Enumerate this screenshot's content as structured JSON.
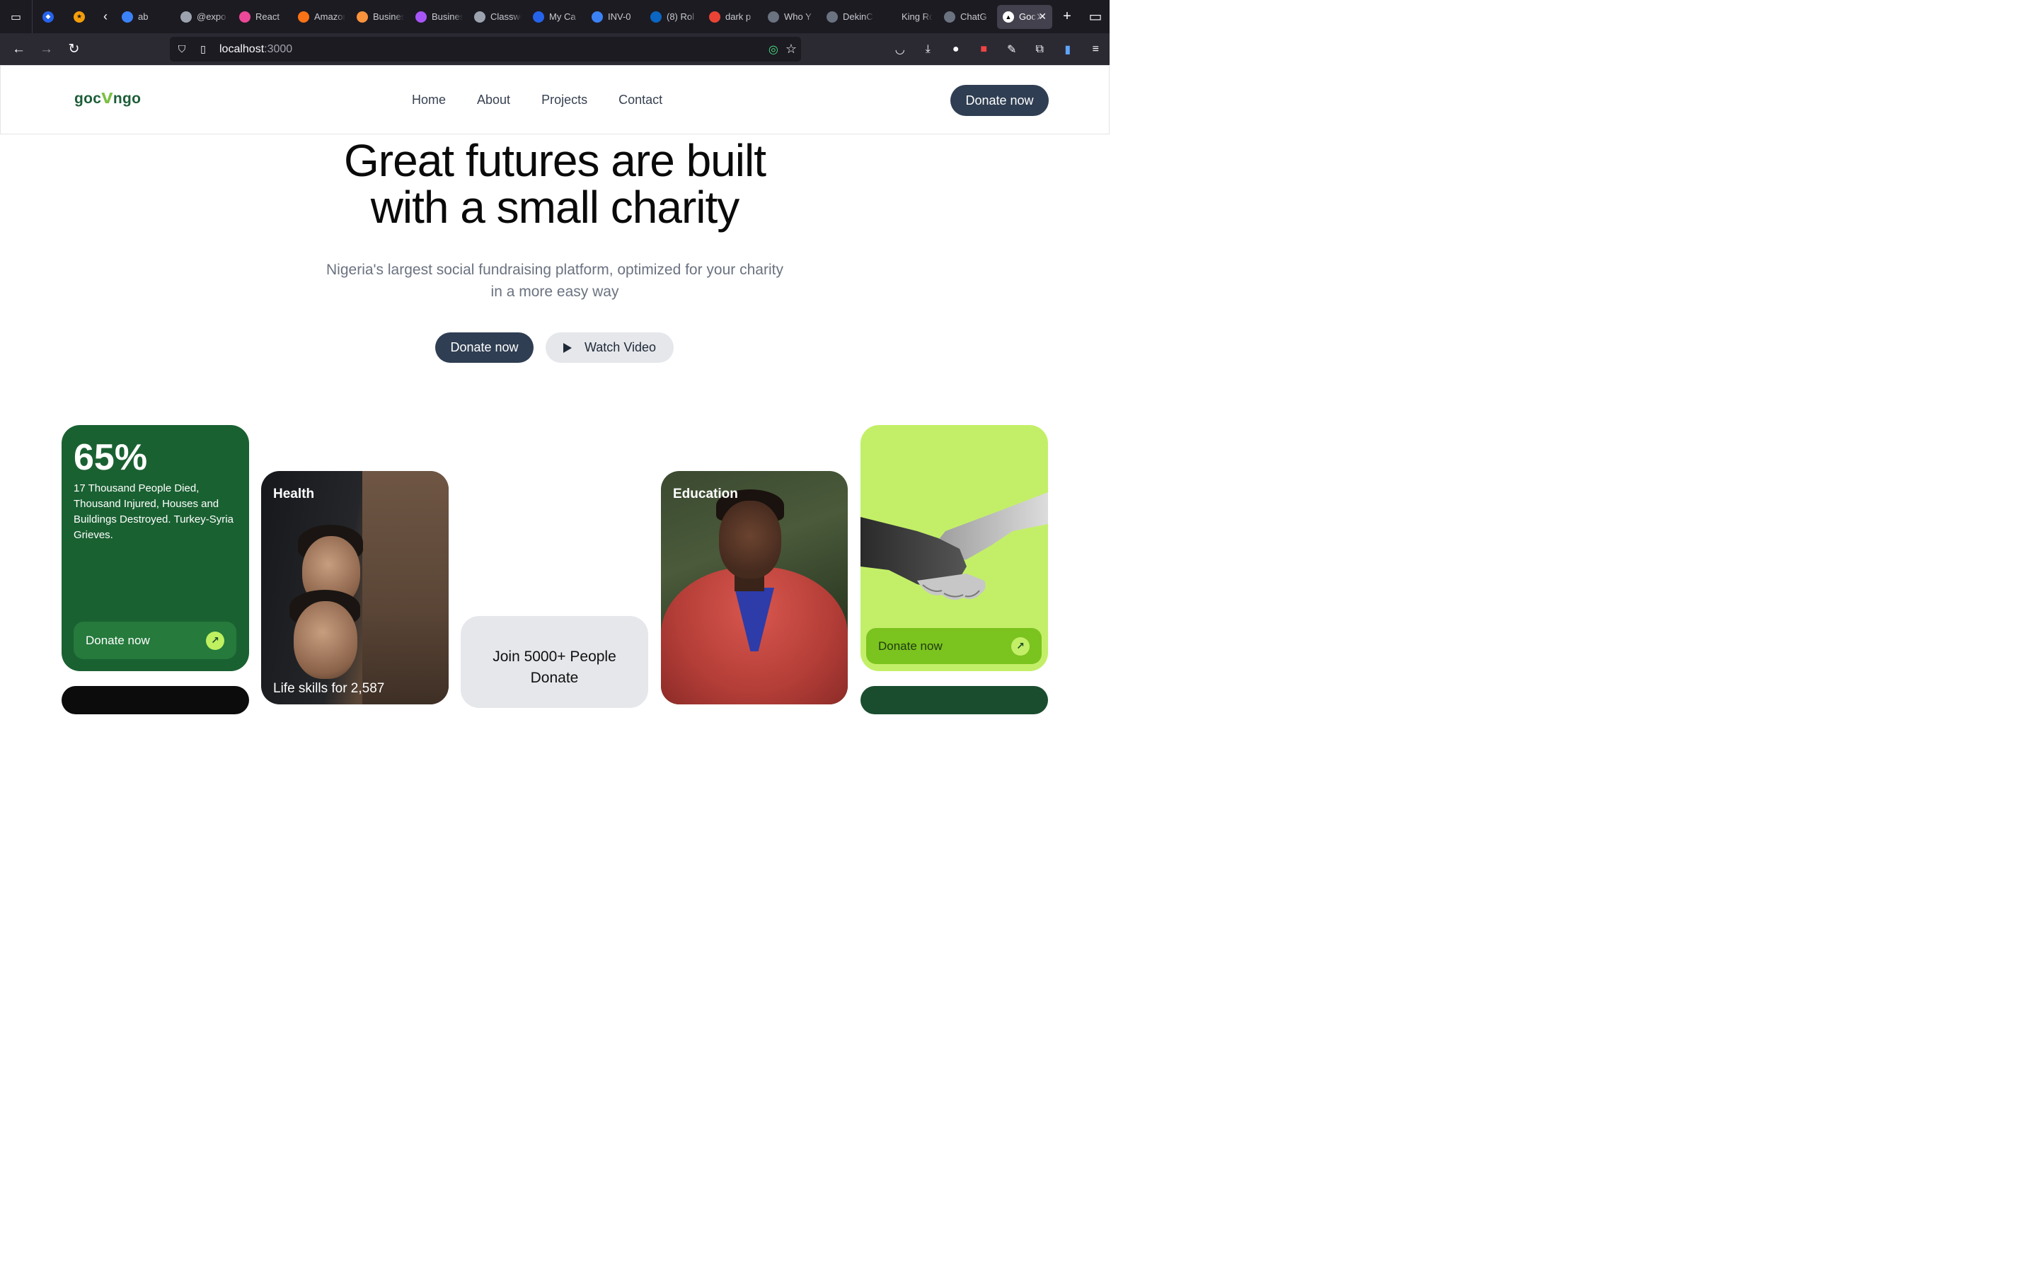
{
  "browser": {
    "tabs": [
      {
        "label": "ab",
        "color": "#3b82f6"
      },
      {
        "label": "@expo",
        "color": "#9ca3af"
      },
      {
        "label": "React",
        "color": "#ec4899"
      },
      {
        "label": "Amazon",
        "color": "#f97316"
      },
      {
        "label": "Business",
        "color": "#fb923c"
      },
      {
        "label": "Business",
        "color": "#a855f7"
      },
      {
        "label": "Classwork",
        "color": "#9ca3af"
      },
      {
        "label": "My Ca",
        "color": "#2563eb"
      },
      {
        "label": "INV-0",
        "color": "#3b82f6"
      },
      {
        "label": "(8) Rol",
        "color": "#0a66c2"
      },
      {
        "label": "dark p",
        "color": "#ea4335"
      },
      {
        "label": "Who Y",
        "color": "#6b7280"
      },
      {
        "label": "DekinC",
        "color": "#6b7280"
      },
      {
        "label": "King Rober",
        "color": "#1c1b22"
      },
      {
        "label": "ChatG",
        "color": "#6b7280"
      }
    ],
    "active_tab": {
      "label": "Goc",
      "color": "#ffffff"
    },
    "url": {
      "host": "localhost",
      "port": ":3000"
    }
  },
  "header": {
    "logo_left": "goc",
    "logo_leaf": "↘",
    "logo_right": "ngo",
    "menu": [
      "Home",
      "About",
      "Projects",
      "Contact"
    ],
    "cta": "Donate now"
  },
  "hero": {
    "title_line1": "Great futures are built",
    "title_line2": "with a small charity",
    "subtitle": "Nigeria's largest social fundraising platform, optimized for your charity in a more easy way",
    "primary_cta": "Donate now",
    "secondary_cta": "Watch Video"
  },
  "cards": {
    "stat": {
      "value": "65%",
      "description": "17 Thousand People Died, Thousand Injured, Houses and Buildings Destroyed. Turkey-Syria Grieves.",
      "button": "Donate now"
    },
    "health": {
      "label": "Health",
      "bottom_text": "Life skills for 2,587"
    },
    "join": {
      "line1": "Join 5000+ People",
      "line2": "Donate"
    },
    "education": {
      "label": "Education"
    },
    "hands": {
      "button": "Donate now"
    }
  },
  "colors": {
    "primary_dark": "#2f3e52",
    "brand_green": "#1a6132",
    "lime": "#c3ef68"
  }
}
